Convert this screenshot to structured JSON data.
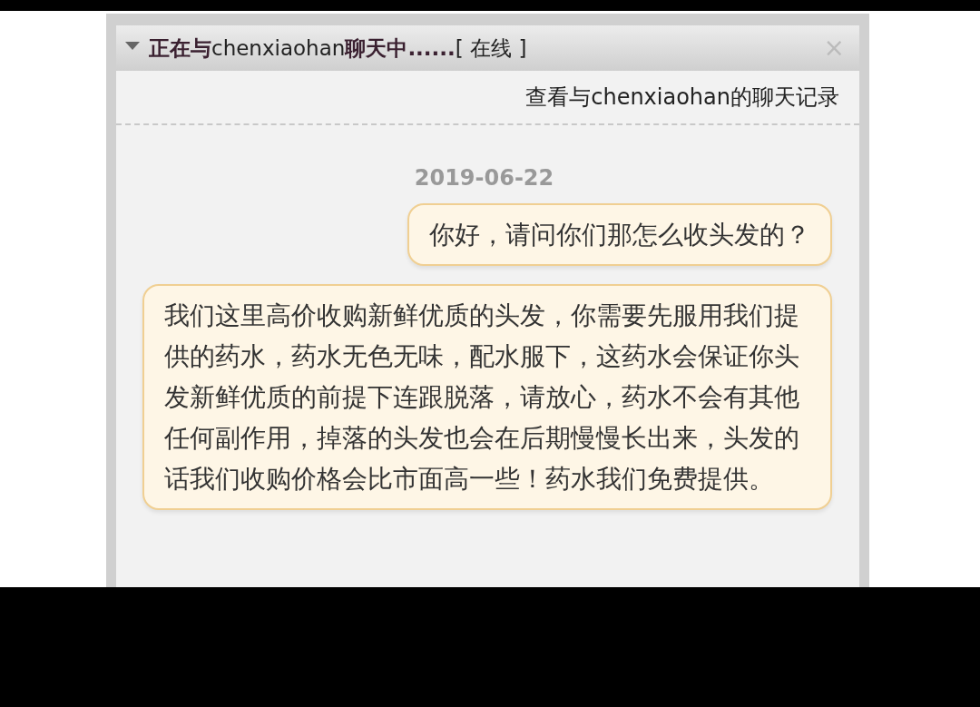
{
  "chat_window": {
    "title": "**正在与**chenxiaohan**聊天中......**[ 在线 ]",
    "close": "×",
    "history_link": "查看与chenxiaohan的聊天记录",
    "date": "2019-06-22",
    "messages": [
      {
        "text": "你好，请问你们那怎么收头发的？"
      },
      {
        "text": "我们这里高价收购新鲜优质的头发，你需要先服用我们提供的药水，药水无色无味，配水服下，这药水会保证你头发新鲜优质的前提下连跟脱落，请放心，药水不会有其他任何副作用，掉落的头发也会在后期慢慢长出来，头发的话我们收购价格会比市面高一些！药水我们免费提供。"
      }
    ]
  }
}
